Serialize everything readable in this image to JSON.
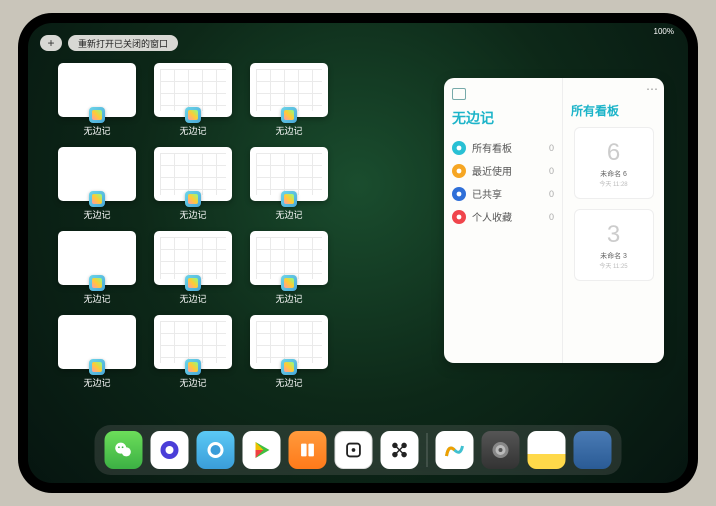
{
  "status": {
    "battery": "100%"
  },
  "topbar": {
    "plus": "+",
    "reopen_label": "重新打开已关闭的窗口"
  },
  "windows": [
    {
      "label": "无边记",
      "variant": "blank"
    },
    {
      "label": "无边记",
      "variant": "grid"
    },
    {
      "label": "无边记",
      "variant": "grid"
    },
    {
      "label": "无边记",
      "variant": "blank"
    },
    {
      "label": "无边记",
      "variant": "grid"
    },
    {
      "label": "无边记",
      "variant": "grid"
    },
    {
      "label": "无边记",
      "variant": "blank"
    },
    {
      "label": "无边记",
      "variant": "grid"
    },
    {
      "label": "无边记",
      "variant": "grid"
    },
    {
      "label": "无边记",
      "variant": "blank"
    },
    {
      "label": "无边记",
      "variant": "grid"
    },
    {
      "label": "无边记",
      "variant": "grid"
    }
  ],
  "panel": {
    "title": "无边记",
    "items": [
      {
        "icon": "cloud",
        "color": "#29c0d4",
        "label": "所有看板",
        "count": 0
      },
      {
        "icon": "clock",
        "color": "#f6a623",
        "label": "最近使用",
        "count": 0
      },
      {
        "icon": "person",
        "color": "#2f6fd8",
        "label": "已共享",
        "count": 0
      },
      {
        "icon": "heart",
        "color": "#f0454c",
        "label": "个人收藏",
        "count": 0
      }
    ],
    "right": {
      "title": "所有看板",
      "cards": [
        {
          "scribble": "6",
          "name": "未命名 6",
          "time": "今天 11:28"
        },
        {
          "scribble": "3",
          "name": "未命名 3",
          "time": "今天 11:25"
        }
      ]
    }
  },
  "dock": {
    "apps": [
      "wechat",
      "quark",
      "qbrowser",
      "cloud",
      "books",
      "white1",
      "white2",
      "freeform",
      "settings",
      "notes",
      "folder"
    ]
  }
}
